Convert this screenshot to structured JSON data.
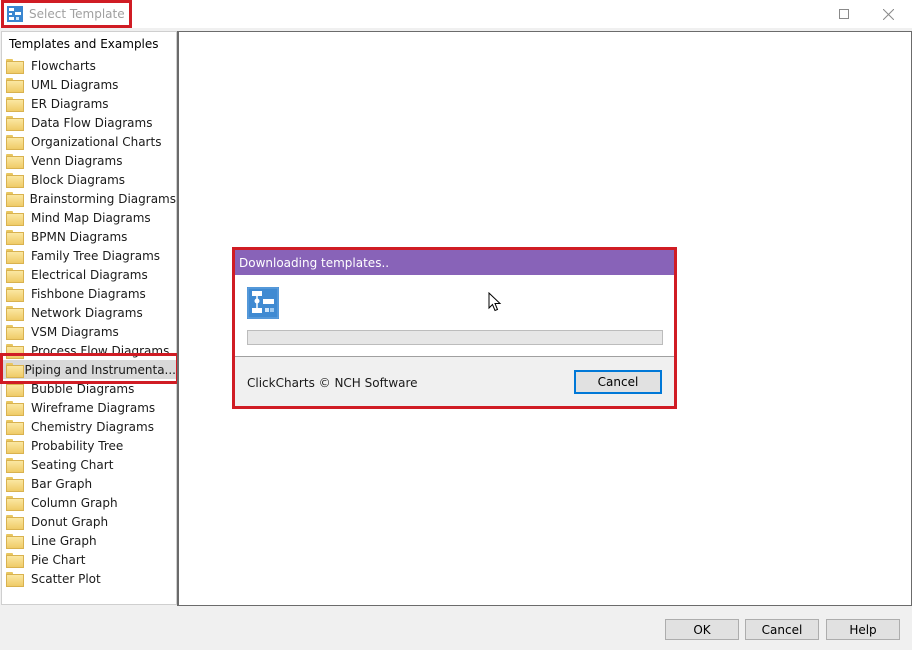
{
  "window": {
    "title": "Select Template",
    "icon": "clickcharts-app-icon",
    "controls": {
      "maximize": "maximize-icon",
      "close": "close-icon"
    }
  },
  "tree": {
    "header": "Templates and Examples",
    "selected_index": 16,
    "items": [
      {
        "label": "Flowcharts"
      },
      {
        "label": "UML Diagrams"
      },
      {
        "label": "ER Diagrams"
      },
      {
        "label": "Data Flow Diagrams"
      },
      {
        "label": "Organizational Charts"
      },
      {
        "label": "Venn Diagrams"
      },
      {
        "label": "Block Diagrams"
      },
      {
        "label": "Brainstorming Diagrams"
      },
      {
        "label": "Mind Map Diagrams"
      },
      {
        "label": "BPMN Diagrams"
      },
      {
        "label": "Family Tree Diagrams"
      },
      {
        "label": "Electrical Diagrams"
      },
      {
        "label": "Fishbone Diagrams"
      },
      {
        "label": "Network Diagrams"
      },
      {
        "label": "VSM Diagrams"
      },
      {
        "label": "Process Flow Diagrams"
      },
      {
        "label": "Piping and Instrumenta..."
      },
      {
        "label": "Bubble Diagrams"
      },
      {
        "label": "Wireframe Diagrams"
      },
      {
        "label": "Chemistry Diagrams"
      },
      {
        "label": "Probability Tree"
      },
      {
        "label": "Seating Chart"
      },
      {
        "label": "Bar Graph"
      },
      {
        "label": "Column Graph"
      },
      {
        "label": "Donut Graph"
      },
      {
        "label": "Line Graph"
      },
      {
        "label": "Pie Chart"
      },
      {
        "label": "Scatter Plot"
      }
    ]
  },
  "progress_dialog": {
    "title": "Downloading templates..",
    "progress_percent": 0,
    "footer_text": "ClickCharts © NCH Software",
    "cancel_label": "Cancel",
    "title_color": "#8863b8"
  },
  "buttons": {
    "ok": "OK",
    "cancel": "Cancel",
    "help": "Help"
  },
  "annotation_color": "#d01c24"
}
